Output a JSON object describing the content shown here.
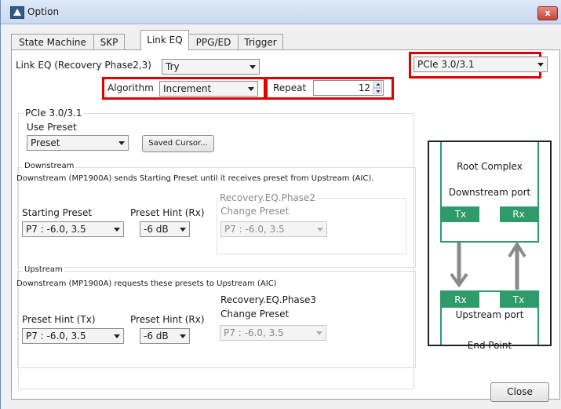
{
  "window": {
    "title": "Option",
    "close_glyph": "x"
  },
  "tabs": [
    {
      "label": "State Machine"
    },
    {
      "label": "SKP"
    },
    {
      "label": "Link EQ"
    },
    {
      "label": "PPG/ED"
    },
    {
      "label": "Trigger"
    }
  ],
  "link_eq": {
    "mode_label": "Link EQ (Recovery Phase2,3)",
    "mode_value": "Try",
    "algorithm_label": "Algorithm",
    "algorithm_value": "Increment",
    "repeat_label": "Repeat",
    "repeat_value": "12",
    "spec_value": "PCIe 3.0/3.1"
  },
  "pcie_group": {
    "title": "PCIe 3.0/3.1",
    "use_preset_label": "Use Preset",
    "use_preset_value": "Preset",
    "saved_cursor_label": "Saved Cursor..."
  },
  "downstream": {
    "title": "Downstream",
    "description": "Downstream (MP1900A) sends Starting Preset until it receives preset from Upstream (AIC).",
    "starting_preset_label": "Starting Preset",
    "starting_preset_value": "P7 : -6.0, 3.5",
    "preset_hint_label": "Preset Hint (Rx)",
    "preset_hint_value": "-6 dB",
    "phase_title": "Recovery.EQ.Phase2",
    "change_preset_label": "Change Preset",
    "change_preset_value": "P7 : -6.0, 3.5"
  },
  "upstream": {
    "title": "Upstream",
    "description": "Downstream (MP1900A) requests these presets to Upstream (AIC)",
    "preset_hint_tx_label": "Preset Hint (Tx)",
    "preset_hint_tx_value": "P7 : -6.0, 3.5",
    "preset_hint_rx_label": "Preset Hint (Rx)",
    "preset_hint_rx_value": "-6 dB",
    "phase_title": "Recovery.EQ.Phase3",
    "change_preset_label": "Change Preset",
    "change_preset_value": "P7 : -6.0, 3.5"
  },
  "diagram": {
    "root_complex": "Root Complex",
    "downstream_port": "Downstream port",
    "tx_top": "Tx",
    "rx_top": "Rx",
    "rx_bottom": "Rx",
    "tx_bottom": "Tx",
    "upstream_port": "Upstream port",
    "end_point": "End Point",
    "accent_color": "#2f9a6a",
    "arrow_color": "#8a8a8a"
  },
  "footer": {
    "close_label": "Close"
  },
  "highlight_color": "#e00000"
}
